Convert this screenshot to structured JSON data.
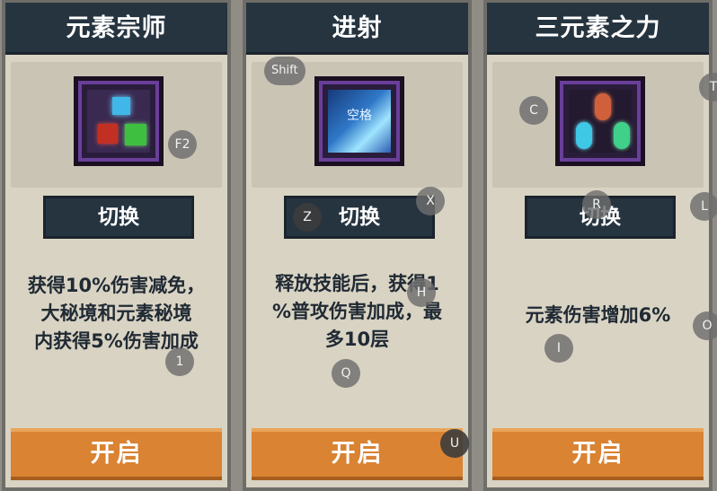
{
  "cards": [
    {
      "title": "元素宗师",
      "switch_label": "切换",
      "desc_lines": [
        "获得10%伤害减免，",
        "大秘境和元素秘境",
        "内获得5%伤害加成"
      ],
      "open_label": "开启"
    },
    {
      "title": "进射",
      "switch_label": "切换",
      "icon_text": "空格",
      "desc_lines": [
        "释放技能后，获得1",
        "%普攻伤害加成，最",
        "多10层"
      ],
      "open_label": "开启"
    },
    {
      "title": "三元素之力",
      "switch_label": "切换",
      "desc_lines": [
        "元素伤害增加6%"
      ],
      "open_label": "开启"
    }
  ],
  "key_hints": {
    "f2": "F2",
    "one": "1",
    "shift": "Shift",
    "z": "Z",
    "x": "X",
    "h": "H",
    "q": "Q",
    "u": "U",
    "c": "C",
    "r": "R",
    "i": "I",
    "t": "T",
    "l": "L",
    "o": "O"
  },
  "colors": {
    "header": "#263440",
    "panel": "#d9d3c3",
    "open_button": "#d98333",
    "text": "#202a34"
  },
  "icons": [
    "elements-icon",
    "spacebar-skill-icon",
    "three-elements-icon"
  ]
}
